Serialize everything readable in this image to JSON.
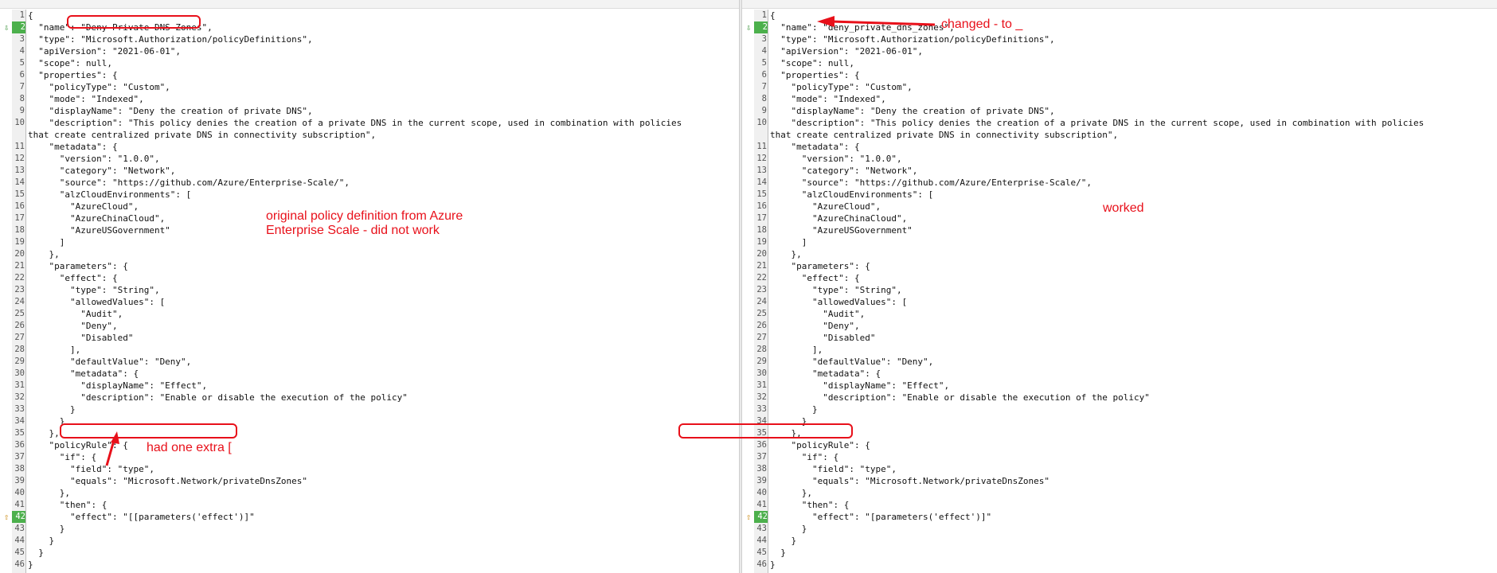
{
  "left": {
    "lines": [
      "{",
      "  \"name\": \"Deny-Private-DNS-Zones\",",
      "  \"type\": \"Microsoft.Authorization/policyDefinitions\",",
      "  \"apiVersion\": \"2021-06-01\",",
      "  \"scope\": null,",
      "  \"properties\": {",
      "    \"policyType\": \"Custom\",",
      "    \"mode\": \"Indexed\",",
      "    \"displayName\": \"Deny the creation of private DNS\",",
      "    \"description\": \"This policy denies the creation of a private DNS in the current scope, used in combination with policies",
      "that create centralized private DNS in connectivity subscription\",",
      "    \"metadata\": {",
      "      \"version\": \"1.0.0\",",
      "      \"category\": \"Network\",",
      "      \"source\": \"https://github.com/Azure/Enterprise-Scale/\",",
      "      \"alzCloudEnvironments\": [",
      "        \"AzureCloud\",",
      "        \"AzureChinaCloud\",",
      "        \"AzureUSGovernment\"",
      "      ]",
      "    },",
      "    \"parameters\": {",
      "      \"effect\": {",
      "        \"type\": \"String\",",
      "        \"allowedValues\": [",
      "          \"Audit\",",
      "          \"Deny\",",
      "          \"Disabled\"",
      "        ],",
      "        \"defaultValue\": \"Deny\",",
      "        \"metadata\": {",
      "          \"displayName\": \"Effect\",",
      "          \"description\": \"Enable or disable the execution of the policy\"",
      "        }",
      "      }",
      "    },",
      "    \"policyRule\": {",
      "      \"if\": {",
      "        \"field\": \"type\",",
      "        \"equals\": \"Microsoft.Network/privateDnsZones\"",
      "      },",
      "      \"then\": {",
      "        \"effect\": \"[[parameters('effect')]\"",
      "      }",
      "    }",
      "  }",
      "}"
    ],
    "line_numbers": [
      "1",
      "2",
      "3",
      "4",
      "5",
      "6",
      "7",
      "8",
      "9",
      "10",
      "",
      "11",
      "12",
      "13",
      "14",
      "15",
      "16",
      "17",
      "18",
      "19",
      "20",
      "21",
      "22",
      "23",
      "24",
      "25",
      "26",
      "27",
      "28",
      "29",
      "30",
      "31",
      "32",
      "33",
      "34",
      "35",
      "36",
      "37",
      "38",
      "39",
      "40",
      "41",
      "42",
      "43",
      "44",
      "45",
      "46"
    ],
    "note_top": "original policy definition from Azure",
    "note_bottom": "Enterprise Scale - did not work",
    "note_bracket": "had one extra ["
  },
  "right": {
    "lines": [
      "{",
      "  \"name\": \"deny_private_dns_zones\",",
      "  \"type\": \"Microsoft.Authorization/policyDefinitions\",",
      "  \"apiVersion\": \"2021-06-01\",",
      "  \"scope\": null,",
      "  \"properties\": {",
      "    \"policyType\": \"Custom\",",
      "    \"mode\": \"Indexed\",",
      "    \"displayName\": \"Deny the creation of private DNS\",",
      "    \"description\": \"This policy denies the creation of a private DNS in the current scope, used in combination with policies",
      "that create centralized private DNS in connectivity subscription\",",
      "    \"metadata\": {",
      "      \"version\": \"1.0.0\",",
      "      \"category\": \"Network\",",
      "      \"source\": \"https://github.com/Azure/Enterprise-Scale/\",",
      "      \"alzCloudEnvironments\": [",
      "        \"AzureCloud\",",
      "        \"AzureChinaCloud\",",
      "        \"AzureUSGovernment\"",
      "      ]",
      "    },",
      "    \"parameters\": {",
      "      \"effect\": {",
      "        \"type\": \"String\",",
      "        \"allowedValues\": [",
      "          \"Audit\",",
      "          \"Deny\",",
      "          \"Disabled\"",
      "        ],",
      "        \"defaultValue\": \"Deny\",",
      "        \"metadata\": {",
      "          \"displayName\": \"Effect\",",
      "          \"description\": \"Enable or disable the execution of the policy\"",
      "        }",
      "      }",
      "    },",
      "    \"policyRule\": {",
      "      \"if\": {",
      "        \"field\": \"type\",",
      "        \"equals\": \"Microsoft.Network/privateDnsZones\"",
      "      },",
      "      \"then\": {",
      "        \"effect\": \"[parameters('effect')]\"",
      "      }",
      "    }",
      "  }",
      "}"
    ],
    "line_numbers": [
      "1",
      "2",
      "3",
      "4",
      "5",
      "6",
      "7",
      "8",
      "9",
      "10",
      "",
      "11",
      "12",
      "13",
      "14",
      "15",
      "16",
      "17",
      "18",
      "19",
      "20",
      "21",
      "22",
      "23",
      "24",
      "25",
      "26",
      "27",
      "28",
      "29",
      "30",
      "31",
      "32",
      "33",
      "34",
      "35",
      "36",
      "37",
      "38",
      "39",
      "40",
      "41",
      "42",
      "43",
      "44",
      "45",
      "46"
    ],
    "note_changed": "changed - to _",
    "note_worked": "worked"
  },
  "colors": {
    "annotation": "#e8101a",
    "changed_line_number": "#4cb04c",
    "selection": "#b7d4ef"
  },
  "icons": {
    "diff_down": "green-down-arrow-icon",
    "diff_up": "orange-up-arrow-icon"
  }
}
